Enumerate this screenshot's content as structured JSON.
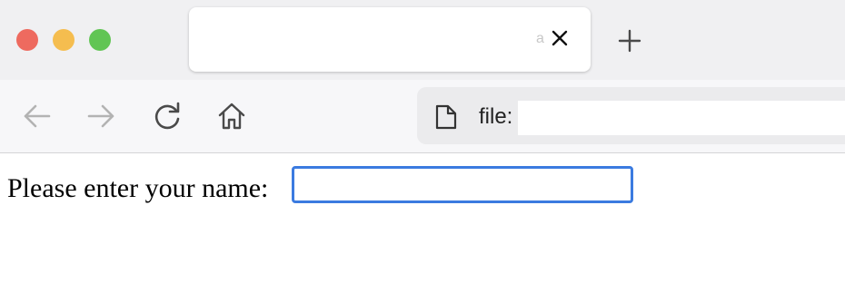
{
  "window": {
    "traffic_lights": [
      {
        "name": "close-window-button",
        "color": "#ee6a5f"
      },
      {
        "name": "minimize-window-button",
        "color": "#f5bd4f"
      },
      {
        "name": "zoom-window-button",
        "color": "#61c554"
      }
    ]
  },
  "tab": {
    "title": "",
    "close_icon": "close-icon",
    "truncated_glyph": "a"
  },
  "new_tab": {
    "icon": "plus-icon"
  },
  "toolbar": {
    "back_icon": "arrow-left-icon",
    "forward_icon": "arrow-right-icon",
    "reload_icon": "reload-icon",
    "home_icon": "home-icon"
  },
  "address_bar": {
    "page_icon": "document-icon",
    "scheme": "file:",
    "url": ""
  },
  "page": {
    "prompt": "Please enter your name:",
    "name_input_value": ""
  },
  "colors": {
    "input_focus_border": "#3b7be0",
    "tabstrip_bg": "#f0f0f2",
    "toolbar_bg": "#f7f7f9"
  }
}
